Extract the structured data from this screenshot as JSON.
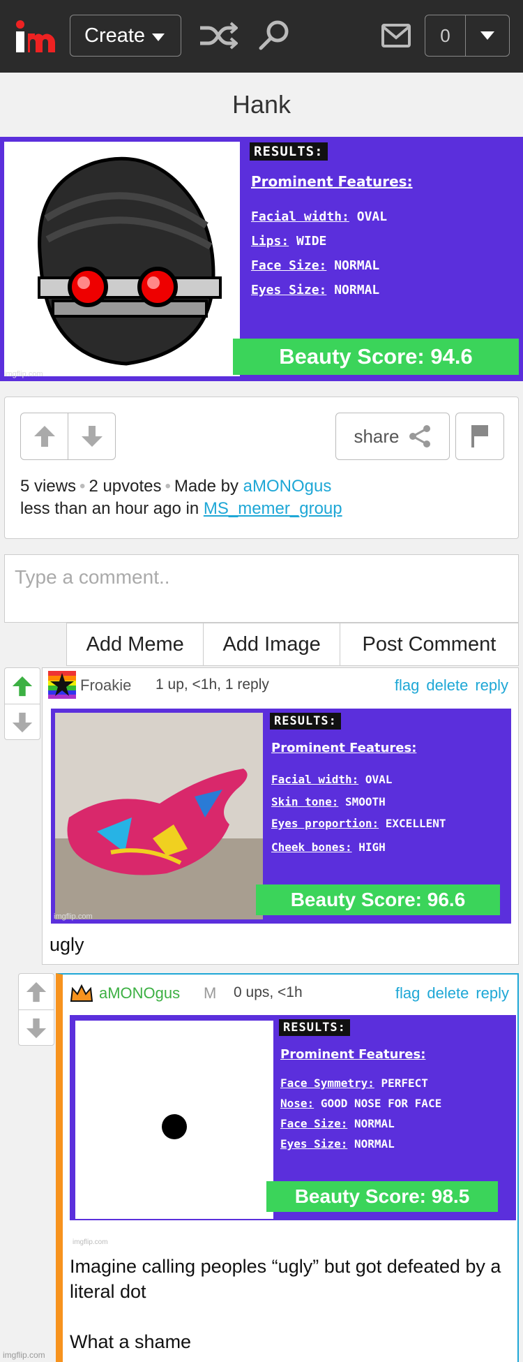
{
  "header": {
    "logo_text": "im",
    "create_label": "Create",
    "notification_count": "0",
    "icons": [
      "shuffle-icon",
      "search-icon",
      "mail-icon",
      "chevron-down-icon"
    ]
  },
  "page": {
    "title": "Hank"
  },
  "post_result": {
    "tag": "RESULTS:",
    "heading": "Prominent Features:",
    "features": [
      {
        "key": "Facial width:",
        "value": "OVAL"
      },
      {
        "key": "Lips:",
        "value": "WIDE"
      },
      {
        "key": "Face Size:",
        "value": "NORMAL"
      },
      {
        "key": "Eyes Size:",
        "value": "NORMAL"
      }
    ],
    "score": "Beauty Score: 94.6",
    "watermark": "imgflip.com"
  },
  "stats": {
    "share_label": "share",
    "views": "5 views",
    "upvotes": "2 upvotes",
    "made_by": "Made by",
    "author": "aMONOgus",
    "time_in": "less than an hour ago in",
    "stream": "MS_memer_group"
  },
  "comment_form": {
    "placeholder": "Type a comment..",
    "add_meme": "Add Meme",
    "add_image": "Add Image",
    "post_comment": "Post Comment"
  },
  "comments": [
    {
      "user": "Froakie",
      "meta": "1 up, <1h, 1 reply",
      "actions": {
        "flag": "flag",
        "delete": "delete",
        "reply": "reply"
      },
      "result": {
        "tag": "RESULTS:",
        "heading": "Prominent Features:",
        "features": [
          {
            "key": "Facial width:",
            "value": "OVAL"
          },
          {
            "key": "Skin tone:",
            "value": "SMOOTH"
          },
          {
            "key": "Eyes proportion:",
            "value": "EXCELLENT"
          },
          {
            "key": "Cheek bones:",
            "value": "HIGH"
          }
        ],
        "score": "Beauty Score: 96.6",
        "watermark": "imgflip.com"
      },
      "text": "ugly"
    },
    {
      "user": "aMONOgus",
      "mod": "M",
      "meta": "0 ups, <1h",
      "actions": {
        "flag": "flag",
        "delete": "delete",
        "reply": "reply"
      },
      "result": {
        "tag": "RESULTS:",
        "heading": "Prominent Features:",
        "features": [
          {
            "key": "Face Symmetry:",
            "value": "PERFECT"
          },
          {
            "key": "Nose:",
            "value": "GOOD NOSE FOR FACE"
          },
          {
            "key": "Face Size:",
            "value": "NORMAL"
          },
          {
            "key": "Eyes Size:",
            "value": "NORMAL"
          }
        ],
        "score": "Beauty Score: 98.5",
        "watermark": "imgflip.com"
      },
      "text": "Imagine calling peoples “ugly” but got defeated by a literal dot\n\nWhat a shame"
    }
  ],
  "footer_watermark": "imgflip.com",
  "colors": {
    "accent": "#1ea7d6",
    "result_bg": "#5b2fdc",
    "score_bg": "#3bd45a",
    "upvote": "#3cb043",
    "mod_orange": "#f7931e"
  }
}
